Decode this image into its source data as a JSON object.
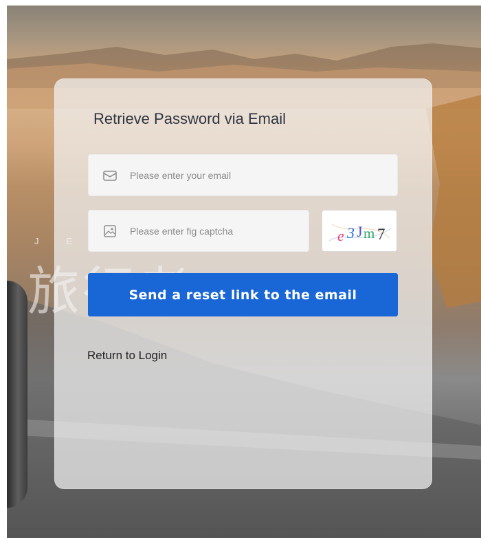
{
  "background": {
    "brand_letters": "J  E",
    "brand_chinese": "旅行者"
  },
  "form": {
    "title": "Retrieve Password via Email",
    "email_placeholder": "Please enter your email",
    "email_value": "",
    "email_icon": "mail-icon",
    "captcha_placeholder": "Please enter fig captcha",
    "captcha_value": "",
    "captcha_icon": "image-icon",
    "captcha_image_text": "e3Jm7",
    "send_label": "Send a reset link to the email",
    "return_label": "Return to Login"
  },
  "colors": {
    "accent": "#1966d6",
    "panel_background": "rgba(242,242,242,0.72)",
    "title_text": "#2f3442"
  }
}
